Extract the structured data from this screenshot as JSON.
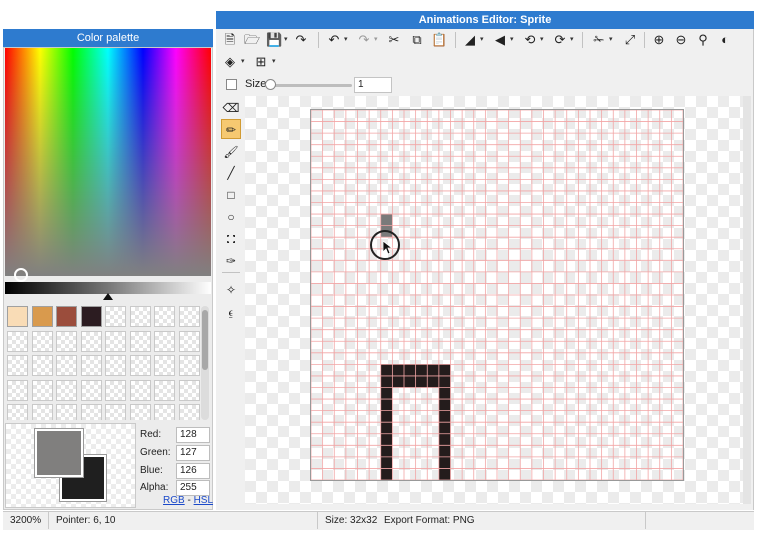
{
  "window": {
    "title": "Animations Editor: Sprite"
  },
  "palette": {
    "title": "Color palette",
    "swatches": [
      "#f9dcb6",
      "#d99a4d",
      "#9b4d3c",
      "#2c1c21"
    ],
    "primary_color": "#807f7e",
    "secondary_color": "#1f1f1f",
    "channels": [
      {
        "label": "Red:",
        "value": "128"
      },
      {
        "label": "Green:",
        "value": "127"
      },
      {
        "label": "Blue:",
        "value": "126"
      },
      {
        "label": "Alpha:",
        "value": "255"
      }
    ],
    "mode_links": {
      "rgb": "RGB",
      "separator": "-",
      "hsl": "HSL"
    }
  },
  "toolbar": {
    "icons": [
      "new-file-icon",
      "open-folder-icon",
      "save-icon",
      "export-icon",
      "undo-icon",
      "redo-icon",
      "cut-icon",
      "copy-icon",
      "paste-icon",
      "flip-horizontal-icon",
      "flip-vertical-icon",
      "rotate-left-icon",
      "rotate-right-icon",
      "crop-icon",
      "resize-icon",
      "zoom-in-icon",
      "zoom-out-icon",
      "zoom-fit-icon",
      "invert-icon",
      "layers-icon",
      "grid-icon"
    ]
  },
  "brush": {
    "size_label": "Size",
    "size_value": "1",
    "size_fraction": 0.0
  },
  "tools": [
    "eraser",
    "pencil",
    "brush",
    "line",
    "rectangle",
    "ellipse",
    "fill",
    "eyedropper",
    "move-pivot",
    "bones"
  ],
  "active_tool": "pencil",
  "sprite": {
    "grid_size": 32,
    "grid_color": "#f2a5a5",
    "pixels": [
      {
        "x": 6,
        "y": 9,
        "color": "#7a7a7a"
      },
      {
        "x": 6,
        "y": 10,
        "color": "#7a7a7a"
      }
    ],
    "shape_color": "#241c1c"
  },
  "status": {
    "zoom": "3200%",
    "pointer": "Pointer: 6, 10",
    "size": "Size: 32x32",
    "export_format": "Export Format: PNG"
  }
}
